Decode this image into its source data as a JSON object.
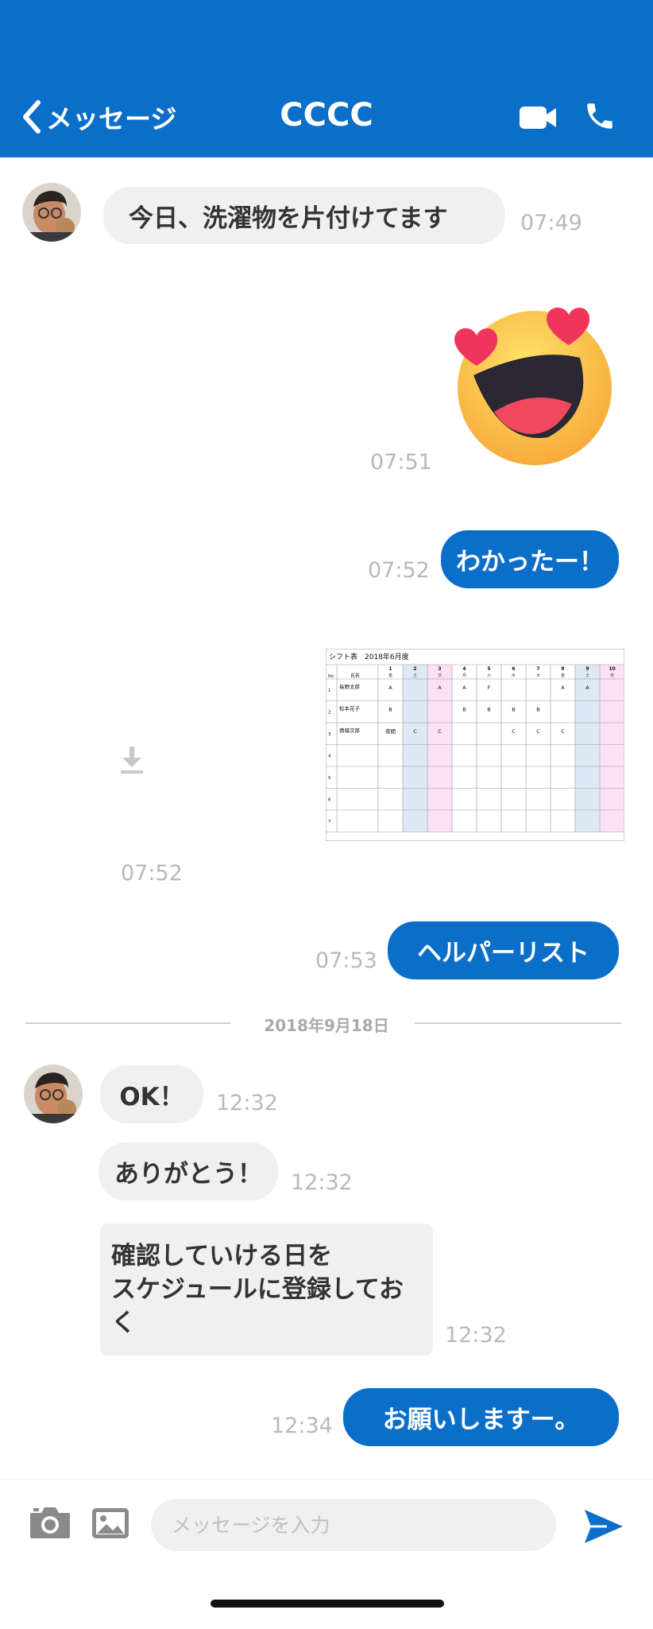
{
  "header": {
    "back_label": "メッセージ",
    "title": "CCCC"
  },
  "messages": {
    "m1": {
      "text": "今日、洗濯物を片付けてます",
      "time": "07:49"
    },
    "m2": {
      "time": "07:51"
    },
    "m3": {
      "text": "わかったー！",
      "time": "07:52"
    },
    "m4": {
      "time": "07:52"
    },
    "m5": {
      "text": "ヘルパーリスト",
      "time": "07:53"
    },
    "m6": {
      "text": "OK！",
      "time": "12:32"
    },
    "m7": {
      "text": "ありがとう！",
      "time": "12:32"
    },
    "m8": {
      "line1": "確認していける日を",
      "line2": "スケジュールに登録しておく",
      "time": "12:32"
    },
    "m9": {
      "text": "お願いしますー。",
      "time": "12:34"
    }
  },
  "date_separator": "2018年9月18日",
  "attachment": {
    "title": "シフト表　2018年6月度",
    "col_no": "No.",
    "col_name": "氏名",
    "days": [
      "1",
      "2",
      "3",
      "4",
      "5",
      "6",
      "7",
      "8",
      "9",
      "10"
    ],
    "weekdays": [
      "金",
      "土",
      "日",
      "月",
      "火",
      "水",
      "木",
      "金",
      "土",
      "日"
    ],
    "rows": [
      {
        "no": "1",
        "name": "長野太郎",
        "cells": [
          "A",
          "",
          "A",
          "A",
          "F",
          "",
          "",
          "A",
          "A",
          ""
        ]
      },
      {
        "no": "2",
        "name": "松本花子",
        "cells": [
          "B",
          "",
          "",
          "B",
          "B",
          "B",
          "B",
          "",
          "",
          ""
        ]
      },
      {
        "no": "3",
        "name": "情報次郎",
        "cells": [
          "夜間",
          "C",
          "C",
          "",
          "",
          "C",
          "C",
          "C",
          "",
          ""
        ]
      },
      {
        "no": "4",
        "name": "",
        "cells": [
          "",
          "",
          "",
          "",
          "",
          "",
          "",
          "",
          "",
          ""
        ]
      },
      {
        "no": "5",
        "name": "",
        "cells": [
          "",
          "",
          "",
          "",
          "",
          "",
          "",
          "",
          "",
          ""
        ]
      },
      {
        "no": "6",
        "name": "",
        "cells": [
          "",
          "",
          "",
          "",
          "",
          "",
          "",
          "",
          "",
          ""
        ]
      },
      {
        "no": "7",
        "name": "",
        "cells": [
          "",
          "",
          "",
          "",
          "",
          "",
          "",
          "",
          "",
          ""
        ]
      }
    ]
  },
  "composer": {
    "placeholder": "メッセージを入力"
  },
  "icons": {
    "back": "chevron-left-icon",
    "video": "video-camera-icon",
    "phone": "phone-icon",
    "download": "download-icon",
    "camera": "camera-icon",
    "image": "image-icon",
    "send": "send-icon"
  },
  "colors": {
    "accent": "#0b6fc9",
    "incoming_bubble": "#f0f0f0",
    "timestamp": "#b9b9b9"
  }
}
